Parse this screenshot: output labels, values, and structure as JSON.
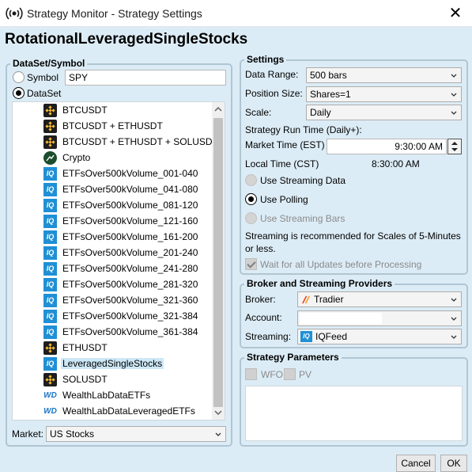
{
  "window": {
    "title": "Strategy Monitor - Strategy Settings",
    "close_glyph": "✕"
  },
  "strategy_name": "RotationalLeveragedSingleStocks",
  "dataset_group": {
    "title": "DataSet/Symbol",
    "symbol_label": "Symbol",
    "symbol_value": "SPY",
    "dataset_label": "DataSet",
    "items": [
      {
        "label": "BTCUSDT",
        "icon": "binance-icon"
      },
      {
        "label": "BTCUSDT + ETHUSDT",
        "icon": "binance-icon"
      },
      {
        "label": "BTCUSDT + ETHUSDT + SOLUSDT",
        "icon": "binance-icon"
      },
      {
        "label": "Crypto",
        "icon": "crypto-icon"
      },
      {
        "label": "ETFsOver500kVolume_001-040",
        "icon": "iqfeed-icon"
      },
      {
        "label": "ETFsOver500kVolume_041-080",
        "icon": "iqfeed-icon"
      },
      {
        "label": "ETFsOver500kVolume_081-120",
        "icon": "iqfeed-icon"
      },
      {
        "label": "ETFsOver500kVolume_121-160",
        "icon": "iqfeed-icon"
      },
      {
        "label": "ETFsOver500kVolume_161-200",
        "icon": "iqfeed-icon"
      },
      {
        "label": "ETFsOver500kVolume_201-240",
        "icon": "iqfeed-icon"
      },
      {
        "label": "ETFsOver500kVolume_241-280",
        "icon": "iqfeed-icon"
      },
      {
        "label": "ETFsOver500kVolume_281-320",
        "icon": "iqfeed-icon"
      },
      {
        "label": "ETFsOver500kVolume_321-360",
        "icon": "iqfeed-icon"
      },
      {
        "label": "ETFsOver500kVolume_321-384",
        "icon": "iqfeed-icon"
      },
      {
        "label": "ETFsOver500kVolume_361-384",
        "icon": "iqfeed-icon"
      },
      {
        "label": "ETHUSDT",
        "icon": "binance-icon"
      },
      {
        "label": "LeveragedSingleStocks",
        "icon": "iqfeed-icon",
        "selected": true
      },
      {
        "label": "SOLUSDT",
        "icon": "binance-icon"
      },
      {
        "label": "WealthLabDataETFs",
        "icon": "wealthdata-icon"
      },
      {
        "label": "WealthLabDataLeveragedETFs",
        "icon": "wealthdata-icon"
      }
    ],
    "market_label": "Market:",
    "market_value": "US Stocks"
  },
  "settings_group": {
    "title": "Settings",
    "data_range_label": "Data Range:",
    "data_range_value": "500 bars",
    "position_size_label": "Position Size:",
    "position_size_value": "Shares=1",
    "scale_label": "Scale:",
    "scale_value": "Daily",
    "run_time_label": "Strategy Run Time (Daily+):",
    "market_time_label": "Market Time (EST)",
    "market_time_value": "9:30:00 AM",
    "local_time_label": "Local Time (CST)",
    "local_time_value": "8:30:00 AM",
    "use_streaming_data": "Use Streaming Data",
    "use_polling": "Use Polling",
    "use_streaming_bars": "Use Streaming Bars",
    "streaming_note": "Streaming is recommended for Scales of 5-Minutes or less.",
    "wait_updates": "Wait for all Updates before Processing"
  },
  "broker_group": {
    "title": "Broker and Streaming Providers",
    "broker_label": "Broker:",
    "broker_value": "Tradier",
    "account_label": "Account:",
    "account_value": "",
    "streaming_label": "Streaming:",
    "streaming_value": "IQFeed"
  },
  "params_group": {
    "title": "Strategy Parameters",
    "wfo_label": "WFO",
    "pv_label": "PV"
  },
  "buttons": {
    "cancel": "Cancel",
    "ok": "OK"
  },
  "colors": {
    "background": "#dcecf6",
    "selection": "#cde8f7",
    "iqfeed_blue": "#1f90d6"
  }
}
